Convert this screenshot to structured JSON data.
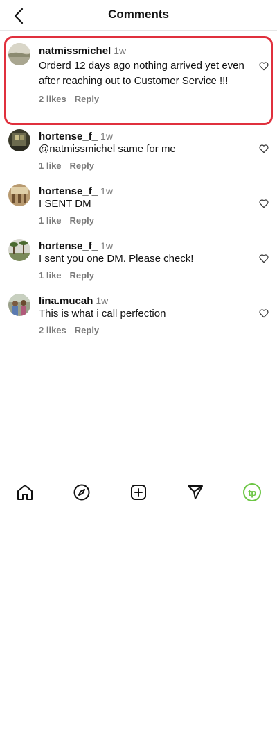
{
  "header": {
    "title": "Comments"
  },
  "comments": [
    {
      "username": "natmissmichel",
      "time": "1w",
      "text": "Orderd 12 days ago nothing arrived yet even after reaching out to Customer Service !!!",
      "likes": "2 likes",
      "reply": "Reply",
      "avatar": "lake-photo-avatar"
    },
    {
      "username": "hortense_f_",
      "time": "1w",
      "text": "@natmissmichel same for me",
      "likes": "1 like",
      "reply": "Reply",
      "avatar": "tram-photo-avatar"
    },
    {
      "username": "hortense_f_",
      "time": "1w",
      "text": "I SENT DM",
      "likes": "1 like",
      "reply": "Reply",
      "avatar": "interior-photo-avatar"
    },
    {
      "username": "hortense_f_",
      "time": "1w",
      "text": "I sent you one DM. Please check!",
      "likes": "1 like",
      "reply": "Reply",
      "avatar": "palm-trees-photo-avatar"
    },
    {
      "username": "lina.mucah",
      "time": "1w",
      "text": "This is what i call perfection",
      "likes": "2 likes",
      "reply": "Reply",
      "avatar": "people-photo-avatar"
    }
  ],
  "tabbar": {
    "icons": [
      "home-icon",
      "explore-compass-icon",
      "create-plus-icon",
      "direct-send-icon",
      "profile-avatar"
    ],
    "profile_initials": "tp"
  },
  "colors": {
    "highlight": "#e0303d",
    "secondary_text": "#7a7a7a",
    "profile_accent": "#6cc644"
  }
}
